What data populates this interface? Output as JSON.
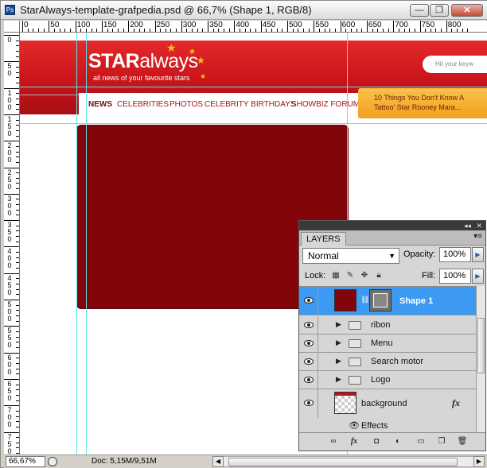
{
  "window": {
    "title": "StarAlways-template-grafpedia.psd @ 66,7% (Shape 1, RGB/8)",
    "app_icon_label": "Ps",
    "controls": {
      "minimize": "—",
      "restore": "❐",
      "close": "✕"
    }
  },
  "rulers": {
    "top_labels": [
      "0",
      "50",
      "100",
      "150",
      "200",
      "250",
      "300",
      "350",
      "400",
      "450",
      "500",
      "550",
      "600",
      "650",
      "700",
      "750",
      "800"
    ],
    "left_labels": [
      "0",
      "5 0",
      "1 0 0",
      "1 5 0",
      "2 0 0",
      "2 5 0",
      "3 0 0",
      "3 5 0",
      "4 0 0",
      "4 5 0",
      "5 0 0",
      "5 5 0",
      "6 0 0",
      "6 5 0",
      "7 0 0",
      "7 5 0"
    ]
  },
  "canvas": {
    "logo_bold": "STAR",
    "logo_light": "always",
    "tagline": "all news of your favourite stars",
    "search_placeholder": "Hit your keyw",
    "nav_items": [
      "NEWS",
      "CELEBRITIES",
      "PHOTOS",
      "CELEBRITY BIRTHDAYS",
      "SHOWBIZ FORUM"
    ],
    "promo_line1": "10 Things You Don't Know A",
    "promo_line2": "Tattoo' Star Rooney Mara...",
    "colors": {
      "header_red": "#c8141a",
      "shape_fill": "#820509",
      "guide": "#5ce3ee",
      "promo": "#f5b232"
    }
  },
  "statusbar": {
    "zoom": "66,67%",
    "doc_info": "Doc: 5,15M/9,51M"
  },
  "layers_panel": {
    "tab_label": "LAYERS",
    "blend_mode": "Normal",
    "opacity_label": "Opacity:",
    "opacity_value": "100%",
    "lock_label": "Lock:",
    "fill_label": "Fill:",
    "fill_value": "100%",
    "layers": [
      {
        "name": "Shape 1",
        "type": "shape",
        "selected": true
      },
      {
        "name": "ribon",
        "type": "group"
      },
      {
        "name": "Menu",
        "type": "group"
      },
      {
        "name": "Search motor",
        "type": "group"
      },
      {
        "name": "Logo",
        "type": "group"
      },
      {
        "name": "background",
        "type": "layer",
        "fx": "fx"
      }
    ],
    "effects_label": "Effects",
    "footer_icons": [
      "link-layers-icon",
      "add-style-icon",
      "add-mask-icon",
      "adjustment-layer-icon",
      "new-group-icon",
      "new-layer-icon",
      "delete-layer-icon"
    ]
  }
}
